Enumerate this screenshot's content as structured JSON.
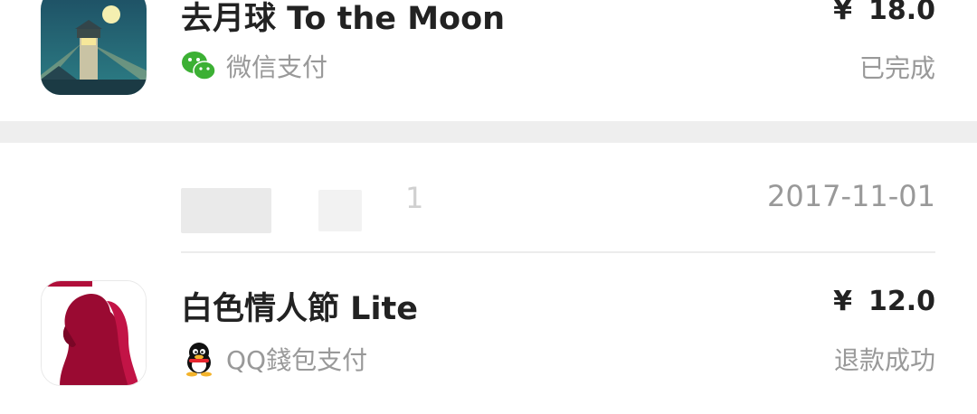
{
  "orders": [
    {
      "app_name": "去月球 To the Moon",
      "app_icon": "to-the-moon-lighthouse-icon",
      "payment_method": "微信支付",
      "payment_icon": "wechat-pay-icon",
      "currency_symbol": "¥",
      "price": "18.0",
      "status": "已完成"
    },
    {
      "date": "2017-11-01",
      "blurred_fragment": "1",
      "app_name": "白色情人節 Lite",
      "app_icon": "white-day-lite-icon",
      "payment_method": "QQ錢包支付",
      "payment_icon": "qq-wallet-icon",
      "currency_symbol": "¥",
      "price": "12.0",
      "status": "退款成功"
    }
  ],
  "colors": {
    "title": "#222222",
    "secondary": "#999999",
    "separator": "#eeeeee",
    "wechat_green": "#3cb034"
  }
}
